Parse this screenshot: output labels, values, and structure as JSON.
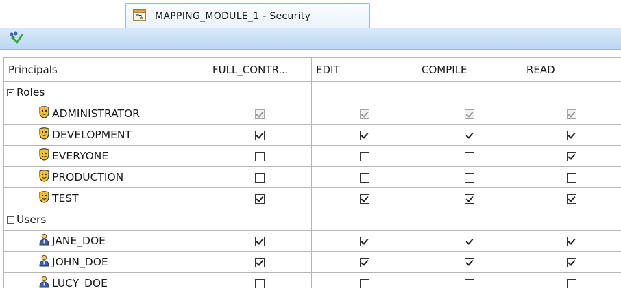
{
  "tab": {
    "title": "MAPPING_MODULE_1 - Security",
    "icon": "mapping-module-icon"
  },
  "toolbar": {
    "icon": "refresh-principals-icon"
  },
  "columns": [
    "Principals",
    "FULL_CONTR...",
    "EDIT",
    "COMPILE",
    "READ"
  ],
  "groups": {
    "roles": {
      "label": "Roles",
      "items": [
        {
          "name": "ADMINISTRATOR",
          "icon": "role-icon",
          "perms": [
            true,
            true,
            true,
            true
          ],
          "disabled": true
        },
        {
          "name": "DEVELOPMENT",
          "icon": "role-icon",
          "perms": [
            true,
            true,
            true,
            true
          ],
          "disabled": false
        },
        {
          "name": "EVERYONE",
          "icon": "role-icon",
          "perms": [
            false,
            false,
            false,
            true
          ],
          "disabled": false
        },
        {
          "name": "PRODUCTION",
          "icon": "role-icon",
          "perms": [
            false,
            false,
            false,
            false
          ],
          "disabled": false
        },
        {
          "name": "TEST",
          "icon": "role-icon",
          "perms": [
            true,
            true,
            true,
            true
          ],
          "disabled": false
        }
      ]
    },
    "users": {
      "label": "Users",
      "items": [
        {
          "name": "JANE_DOE",
          "icon": "user-icon",
          "perms": [
            true,
            true,
            true,
            true
          ],
          "disabled": false
        },
        {
          "name": "JOHN_DOE",
          "icon": "user-icon",
          "perms": [
            true,
            true,
            true,
            true
          ],
          "disabled": false
        },
        {
          "name": "LUCY_DOE",
          "icon": "user-icon",
          "perms": [
            false,
            false,
            false,
            false
          ],
          "disabled": false
        }
      ]
    }
  }
}
